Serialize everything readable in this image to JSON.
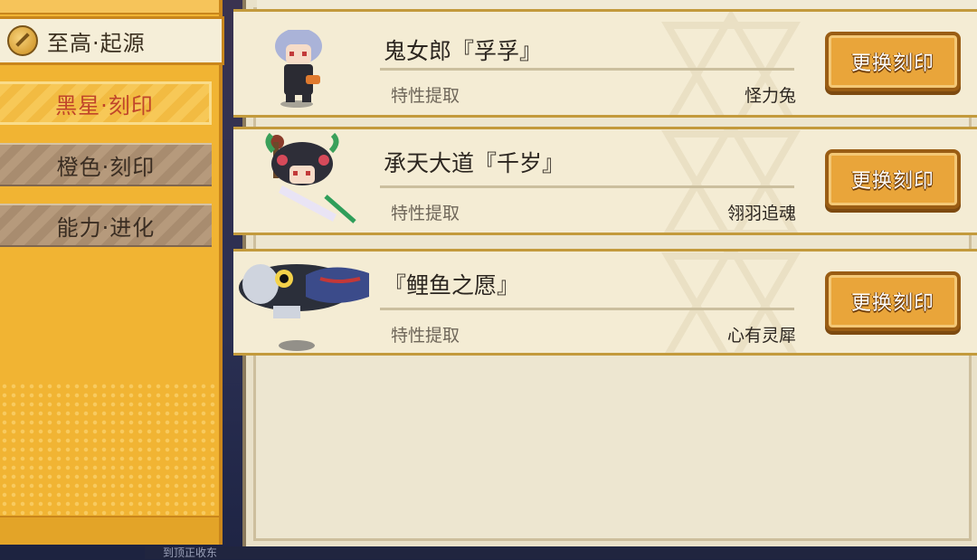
{
  "sidebar": {
    "header_tab": {
      "label": "至高·起源"
    },
    "tabs": [
      {
        "label": "黑星·刻印",
        "state": "selected"
      },
      {
        "label": "橙色·刻印",
        "state": "normal"
      },
      {
        "label": "能力·进化",
        "state": "normal"
      }
    ]
  },
  "cards": [
    {
      "name": "鬼女郎『孚孚』",
      "attr_label": "特性提取",
      "attr_value": "怪力兔",
      "button_label": "更换刻印",
      "avatar": "white-haired-girl-icon"
    },
    {
      "name": "承天大道『千岁』",
      "attr_label": "特性提取",
      "attr_value": "翎羽追魂",
      "button_label": "更换刻印",
      "avatar": "ornate-headdress-girl-icon"
    },
    {
      "name": "『鲤鱼之愿』",
      "attr_label": "特性提取",
      "attr_value": "心有灵犀",
      "button_label": "更换刻印",
      "avatar": "koinobori-carp-icon"
    }
  ],
  "footer": {
    "partial_text": "到顶正收东"
  },
  "colors": {
    "sidebar_gold": "#f1b433",
    "panel_bg": "#e9e1c9",
    "button_orange": "#e9a53a",
    "selected_tab_text": "#c0452a"
  }
}
